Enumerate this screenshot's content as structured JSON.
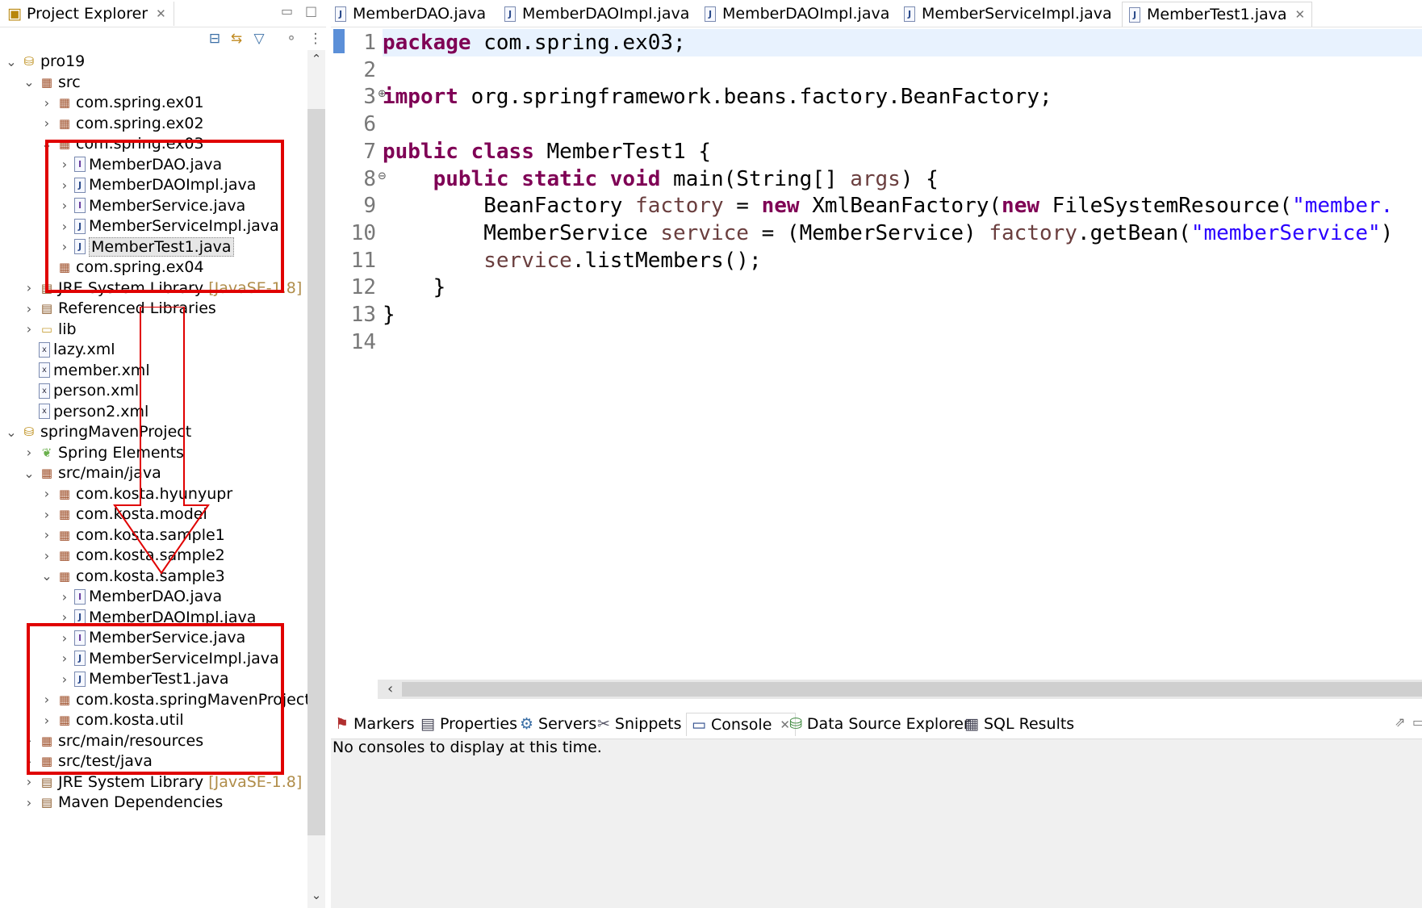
{
  "explorer": {
    "tab_title": "Project Explorer",
    "tree": [
      {
        "label": "pro19",
        "depth": 0,
        "twisty": "open",
        "icon": "project-icon"
      },
      {
        "label": "src",
        "depth": 1,
        "twisty": "open",
        "icon": "source-folder-icon"
      },
      {
        "label": "com.spring.ex01",
        "depth": 2,
        "twisty": "closed",
        "icon": "package-icon"
      },
      {
        "label": "com.spring.ex02",
        "depth": 2,
        "twisty": "closed",
        "icon": "package-icon"
      },
      {
        "label": "com.spring.ex03",
        "depth": 2,
        "twisty": "open",
        "icon": "package-icon"
      },
      {
        "label": "MemberDAO.java",
        "depth": 3,
        "twisty": "closed",
        "icon": "interface-file-icon"
      },
      {
        "label": "MemberDAOImpl.java",
        "depth": 3,
        "twisty": "closed",
        "icon": "java-file-icon"
      },
      {
        "label": "MemberService.java",
        "depth": 3,
        "twisty": "closed",
        "icon": "interface-file-icon"
      },
      {
        "label": "MemberServiceImpl.java",
        "depth": 3,
        "twisty": "closed",
        "icon": "java-file-icon"
      },
      {
        "label": "MemberTest1.java",
        "depth": 3,
        "twisty": "closed",
        "icon": "java-file-icon",
        "selected": true
      },
      {
        "label": "com.spring.ex04",
        "depth": 2,
        "twisty": "closed",
        "icon": "package-icon"
      },
      {
        "label": "JRE System Library",
        "suffix": "[JavaSE-1.8]",
        "depth": 1,
        "twisty": "closed",
        "icon": "library-icon"
      },
      {
        "label": "Referenced Libraries",
        "depth": 1,
        "twisty": "closed",
        "icon": "library-icon"
      },
      {
        "label": "lib",
        "depth": 1,
        "twisty": "closed",
        "icon": "folder-icon"
      },
      {
        "label": "lazy.xml",
        "depth": 1,
        "twisty": "none",
        "icon": "xml-file-icon"
      },
      {
        "label": "member.xml",
        "depth": 1,
        "twisty": "none",
        "icon": "xml-file-icon"
      },
      {
        "label": "person.xml",
        "depth": 1,
        "twisty": "none",
        "icon": "xml-file-icon"
      },
      {
        "label": "person2.xml",
        "depth": 1,
        "twisty": "none",
        "icon": "xml-file-icon"
      },
      {
        "label": "springMavenProject",
        "depth": 0,
        "twisty": "open",
        "icon": "maven-project-icon"
      },
      {
        "label": "Spring Elements",
        "depth": 1,
        "twisty": "closed",
        "icon": "spring-leaf-icon"
      },
      {
        "label": "src/main/java",
        "depth": 1,
        "twisty": "open",
        "icon": "source-folder-icon"
      },
      {
        "label": "com.kosta.hyunyupr",
        "depth": 2,
        "twisty": "closed",
        "icon": "package-icon"
      },
      {
        "label": "com.kosta.model",
        "depth": 2,
        "twisty": "closed",
        "icon": "package-icon"
      },
      {
        "label": "com.kosta.sample1",
        "depth": 2,
        "twisty": "closed",
        "icon": "package-icon"
      },
      {
        "label": "com.kosta.sample2",
        "depth": 2,
        "twisty": "closed",
        "icon": "package-icon"
      },
      {
        "label": "com.kosta.sample3",
        "depth": 2,
        "twisty": "open",
        "icon": "package-icon"
      },
      {
        "label": "MemberDAO.java",
        "depth": 3,
        "twisty": "closed",
        "icon": "interface-file-icon"
      },
      {
        "label": "MemberDAOImpl.java",
        "depth": 3,
        "twisty": "closed",
        "icon": "java-file-icon"
      },
      {
        "label": "MemberService.java",
        "depth": 3,
        "twisty": "closed",
        "icon": "interface-file-icon"
      },
      {
        "label": "MemberServiceImpl.java",
        "depth": 3,
        "twisty": "closed",
        "icon": "java-file-icon"
      },
      {
        "label": "MemberTest1.java",
        "depth": 3,
        "twisty": "closed",
        "icon": "java-file-icon"
      },
      {
        "label": "com.kosta.springMavenProject",
        "depth": 2,
        "twisty": "closed",
        "icon": "package-icon"
      },
      {
        "label": "com.kosta.util",
        "depth": 2,
        "twisty": "closed",
        "icon": "package-icon"
      },
      {
        "label": "src/main/resources",
        "depth": 1,
        "twisty": "closed",
        "icon": "source-folder-icon"
      },
      {
        "label": "src/test/java",
        "depth": 1,
        "twisty": "closed",
        "icon": "source-folder-icon"
      },
      {
        "label": "JRE System Library",
        "suffix": "[JavaSE-1.8]",
        "depth": 1,
        "twisty": "closed",
        "icon": "library-icon"
      },
      {
        "label": "Maven Dependencies",
        "depth": 1,
        "twisty": "closed",
        "icon": "library-icon"
      }
    ]
  },
  "editor": {
    "tabs": [
      {
        "label": "MemberDAO.java",
        "active": false
      },
      {
        "label": "MemberDAOImpl.java",
        "active": false
      },
      {
        "label": "MemberDAOImpl.java",
        "active": false
      },
      {
        "label": "MemberServiceImpl.java",
        "active": false
      },
      {
        "label": "MemberTest1.java",
        "active": true
      }
    ],
    "line_numbers": [
      "1",
      "2",
      "3",
      "6",
      "7",
      "8",
      "9",
      "10",
      "11",
      "12",
      "13",
      "14"
    ],
    "code_lines": [
      [
        {
          "t": "package",
          "c": "kw"
        },
        {
          "t": " com.spring.ex03;",
          "c": ""
        }
      ],
      [],
      [
        {
          "t": "import",
          "c": "kw"
        },
        {
          "t": " org.springframework.beans.factory.BeanFactory;",
          "c": ""
        }
      ],
      [],
      [
        {
          "t": "public",
          "c": "kw"
        },
        {
          "t": " ",
          "c": ""
        },
        {
          "t": "class",
          "c": "kw"
        },
        {
          "t": " MemberTest1 {",
          "c": ""
        }
      ],
      [
        {
          "t": "    ",
          "c": ""
        },
        {
          "t": "public",
          "c": "kw"
        },
        {
          "t": " ",
          "c": ""
        },
        {
          "t": "static",
          "c": "kw"
        },
        {
          "t": " ",
          "c": ""
        },
        {
          "t": "void",
          "c": "kw"
        },
        {
          "t": " main(String[] ",
          "c": ""
        },
        {
          "t": "args",
          "c": "var"
        },
        {
          "t": ") {",
          "c": ""
        }
      ],
      [
        {
          "t": "        BeanFactory ",
          "c": ""
        },
        {
          "t": "factory",
          "c": "var"
        },
        {
          "t": " = ",
          "c": ""
        },
        {
          "t": "new",
          "c": "kw"
        },
        {
          "t": " XmlBeanFactory(",
          "c": ""
        },
        {
          "t": "new",
          "c": "kw"
        },
        {
          "t": " FileSystemResource(",
          "c": ""
        },
        {
          "t": "\"member.",
          "c": "str"
        }
      ],
      [
        {
          "t": "        MemberService ",
          "c": ""
        },
        {
          "t": "service",
          "c": "var"
        },
        {
          "t": " = (MemberService) ",
          "c": ""
        },
        {
          "t": "factory",
          "c": "var"
        },
        {
          "t": ".getBean(",
          "c": ""
        },
        {
          "t": "\"memberService\"",
          "c": "str"
        },
        {
          "t": ")",
          "c": ""
        }
      ],
      [
        {
          "t": "        ",
          "c": ""
        },
        {
          "t": "service",
          "c": "var"
        },
        {
          "t": ".listMembers();",
          "c": ""
        }
      ],
      [
        {
          "t": "    }",
          "c": ""
        }
      ],
      [
        {
          "t": "}",
          "c": ""
        }
      ],
      []
    ]
  },
  "console": {
    "tabs": [
      {
        "label": "Markers",
        "icon": "markers-icon"
      },
      {
        "label": "Properties",
        "icon": "properties-icon"
      },
      {
        "label": "Servers",
        "icon": "servers-icon"
      },
      {
        "label": "Snippets",
        "icon": "snippets-icon"
      },
      {
        "label": "Console",
        "icon": "console-icon",
        "active": true
      },
      {
        "label": "Data Source Explorer",
        "icon": "data-source-icon"
      },
      {
        "label": "SQL Results",
        "icon": "sql-results-icon"
      }
    ],
    "message": "No consoles to display at this time."
  },
  "colors": {
    "annotation_red": "#e00000",
    "keyword": "#7f0055",
    "string": "#2a00ff",
    "local_variable": "#6a3e3e"
  }
}
